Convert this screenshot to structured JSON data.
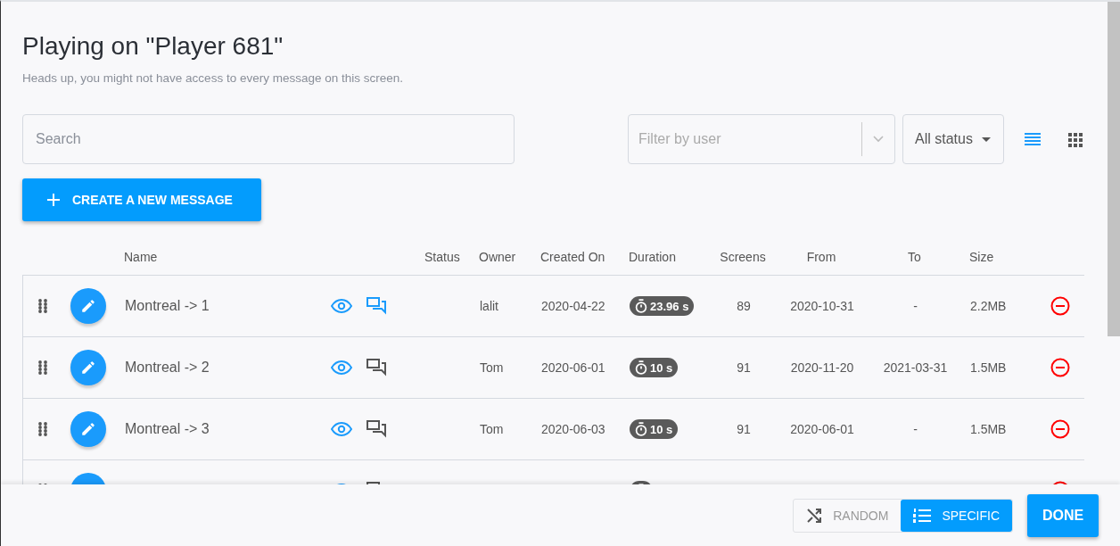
{
  "title": "Playing on \"Player 681\"",
  "subtitle": "Heads up, you might not have access to every message on this screen.",
  "search": {
    "placeholder": "Search"
  },
  "user_filter": {
    "placeholder": "Filter by user"
  },
  "status_filter": {
    "value": "All status"
  },
  "views": [
    {
      "kind": "list",
      "selected": true
    },
    {
      "kind": "grid",
      "selected": false
    }
  ],
  "create_button": {
    "label": "CREATE A NEW MESSAGE"
  },
  "table": {
    "columns": [
      "Name",
      "Status",
      "Owner",
      "Created On",
      "Duration",
      "Screens",
      "From",
      "To",
      "Size"
    ],
    "rows": [
      {
        "name": "Montreal -> 1",
        "comments_active": true,
        "owner": "lalit",
        "created_on": "2020-04-22",
        "duration": "23.96 s",
        "screens": "89",
        "from": "2020-10-31",
        "to": "-",
        "size": "2.2MB"
      },
      {
        "name": "Montreal -> 2",
        "comments_active": false,
        "owner": "Tom",
        "created_on": "2020-06-01",
        "duration": "10 s",
        "screens": "91",
        "from": "2020-11-20",
        "to": "2021-03-31",
        "size": "1.5MB"
      },
      {
        "name": "Montreal -> 3",
        "comments_active": false,
        "owner": "Tom",
        "created_on": "2020-06-03",
        "duration": "10 s",
        "screens": "91",
        "from": "2020-06-01",
        "to": "-",
        "size": "1.5MB"
      },
      {
        "comments_active": false
      }
    ]
  },
  "play_modes": [
    {
      "kind": "random",
      "label": "RANDOM",
      "selected": false
    },
    {
      "kind": "specific",
      "label": "SPECIFIC",
      "selected": true
    }
  ],
  "done_button": {
    "label": "DONE"
  }
}
